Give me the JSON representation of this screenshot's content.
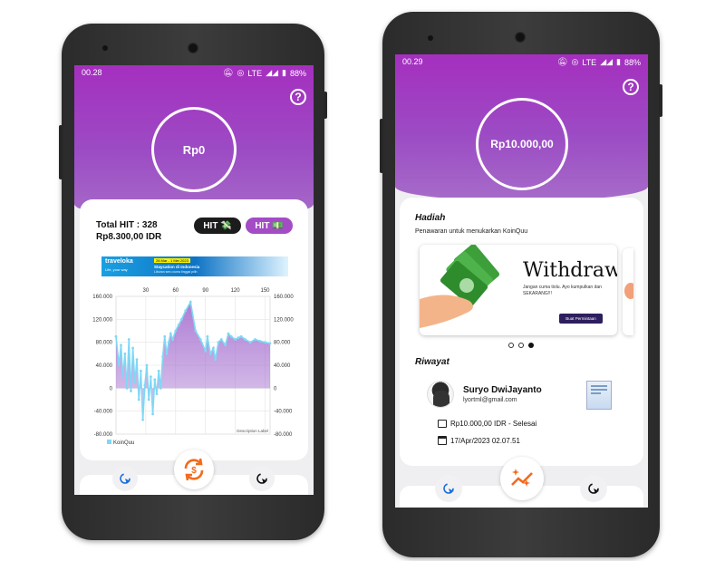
{
  "left_phone": {
    "status": {
      "time": "00.28",
      "network": "LTE",
      "battery": "88%"
    },
    "help_label": "?",
    "balance": "Rp0",
    "total_hit_label": "Total HIT : 328",
    "total_idr": "Rp8.300,00 IDR",
    "hit_btn_1": "HIT 💸",
    "hit_btn_2": "HIT 💵",
    "ad": {
      "brand": "traveloka",
      "tagline": "Life, your way",
      "badge": "28 Mar - 1 Mei 2023",
      "text": "Staycation di Indonesia",
      "extra": "Liburan seru cuma tinggal pilih"
    },
    "chart_data": {
      "type": "area",
      "legend": [
        "KoinQuu"
      ],
      "legend_position": "bottom-left",
      "x_ticks": [
        "30",
        "60",
        "90",
        "120",
        "150"
      ],
      "y_ticks": [
        "160.000",
        "120.000",
        "80.000",
        "40.000",
        "0",
        "-40.000",
        "-80.000"
      ],
      "y_ticks_right": [
        "160.000",
        "120.000",
        "80.000",
        "40.000",
        "0",
        "-40.000",
        "-80.000"
      ],
      "ylim": [
        -80000,
        160000
      ],
      "xlim": [
        0,
        155
      ],
      "grid": true,
      "color": "#a56fcf",
      "point_color": "#7fd8f5",
      "description_label": "Description Label",
      "series": [
        {
          "name": "KoinQuu",
          "x": [
            0,
            3,
            5,
            7,
            9,
            11,
            13,
            15,
            17,
            19,
            21,
            23,
            25,
            27,
            29,
            31,
            33,
            35,
            37,
            39,
            41,
            43,
            45,
            47,
            49,
            51,
            53,
            55,
            57,
            60,
            63,
            66,
            70,
            75,
            80,
            85,
            90,
            92,
            95,
            98,
            100,
            103,
            106,
            110,
            113,
            116,
            120,
            123,
            126,
            130,
            135,
            140,
            145,
            150,
            155
          ],
          "y": [
            90000,
            40000,
            75000,
            20000,
            60000,
            0,
            85000,
            -5000,
            70000,
            10000,
            50000,
            -20000,
            30000,
            -55000,
            5000,
            40000,
            -20000,
            20000,
            -45000,
            15000,
            -10000,
            30000,
            0,
            55000,
            90000,
            60000,
            80000,
            95000,
            85000,
            100000,
            110000,
            120000,
            135000,
            150000,
            100000,
            85000,
            65000,
            90000,
            60000,
            70000,
            50000,
            80000,
            85000,
            75000,
            95000,
            90000,
            85000,
            88000,
            90000,
            85000,
            80000,
            85000,
            82000,
            80000,
            78000
          ]
        }
      ]
    },
    "nav": {
      "left_icon": "cursor-click-icon",
      "center_icon": "exchange-icon",
      "right_icon": "cursor-click-icon"
    }
  },
  "right_phone": {
    "status": {
      "time": "00.29",
      "network": "LTE",
      "battery": "88%"
    },
    "help_label": "?",
    "balance": "Rp10.000,00",
    "hadiah_title": "Hadiah",
    "hadiah_subtitle": "Penawaran untuk menukarkan KoinQuu",
    "banner": {
      "title": "Withdraw",
      "desc": "Jangan cuma tiolu. Ayo kumpulkan dan SEKARANG!!!",
      "button": "Buat Permintaan"
    },
    "riwayat_title": "Riwayat",
    "history": {
      "name": "Suryo DwiJayanto",
      "email": "lyortml@gmail.com",
      "amount": "Rp10.000,00 IDR - Selesai",
      "date": "17/Apr/2023 02.07.51"
    },
    "nav": {
      "left_icon": "cursor-click-icon",
      "center_icon": "sparkle-chart-icon",
      "right_icon": "cursor-click-icon"
    }
  }
}
